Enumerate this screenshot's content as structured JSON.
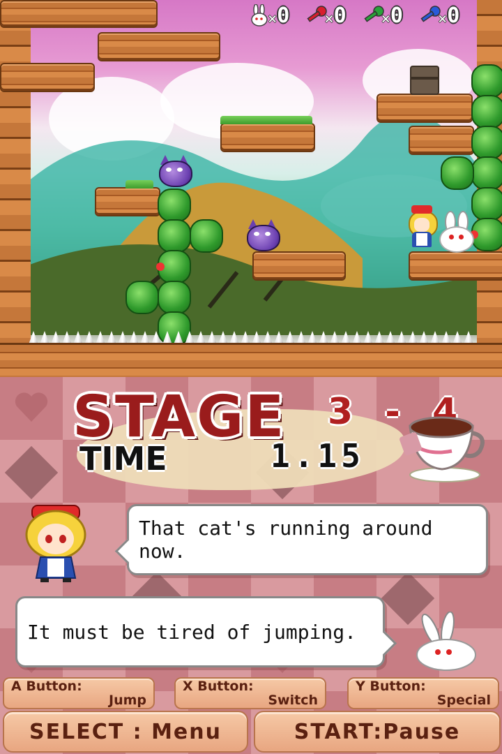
{
  "hud": {
    "items": [
      {
        "icon": "rabbit-icon",
        "count": "0"
      },
      {
        "icon": "red-key-icon",
        "count": "0",
        "color": "#d81e2e"
      },
      {
        "icon": "green-key-icon",
        "count": "0",
        "color": "#2aa23a"
      },
      {
        "icon": "blue-key-icon",
        "count": "0",
        "color": "#2a5ad8"
      }
    ],
    "multiplier": "×"
  },
  "stage": {
    "title": "STAGE",
    "number": "3 - 4",
    "time_label": "TIME",
    "time_value": "1.15"
  },
  "dialogue": {
    "line1": "That cat's running around now.",
    "line2": "It must be tired of jumping."
  },
  "controls": {
    "a_button": {
      "key": "A Button:",
      "action": "Jump"
    },
    "x_button": {
      "key": "X Button:",
      "action": "Switch"
    },
    "y_button": {
      "key": "Y Button:",
      "action": "Special"
    },
    "select": "SELECT : Menu",
    "start": "START:Pause"
  },
  "colors": {
    "title_red": "#9a1c1c",
    "button_bg": "#e8a681",
    "checker_light": "#d99a9f",
    "checker_dark": "#c77d84"
  }
}
